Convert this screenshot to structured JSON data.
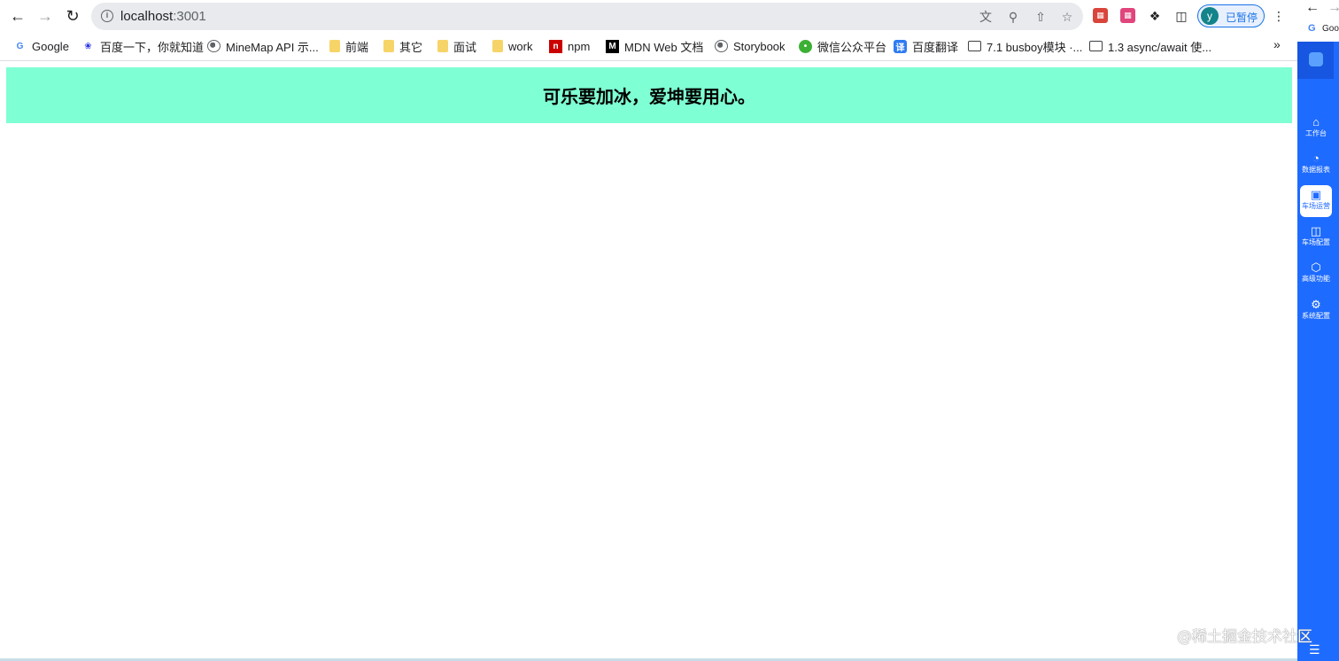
{
  "browser": {
    "url_host": "localhost",
    "url_port": ":3001",
    "profile": {
      "initial": "y",
      "status": "已暂停"
    },
    "bookmarks": [
      {
        "label": "Google",
        "icon": "google-icon"
      },
      {
        "label": "百度一下，你就知道",
        "icon": "baidu-icon"
      },
      {
        "label": "MineMap API 示...",
        "icon": "globe-icon"
      },
      {
        "label": "前端",
        "icon": "folder-icon"
      },
      {
        "label": "其它",
        "icon": "folder-icon"
      },
      {
        "label": "面试",
        "icon": "folder-icon"
      },
      {
        "label": "work",
        "icon": "folder-icon"
      },
      {
        "label": "npm",
        "icon": "npm-icon"
      },
      {
        "label": "MDN Web 文档",
        "icon": "mdn-icon"
      },
      {
        "label": "Storybook",
        "icon": "globe-icon"
      },
      {
        "label": "微信公众平台",
        "icon": "wechat-icon"
      },
      {
        "label": "百度翻译",
        "icon": "translate-icon"
      },
      {
        "label": "7.1 busboy模块 ·...",
        "icon": "book-icon"
      },
      {
        "label": "1.3 async/await 使...",
        "icon": "book-icon"
      }
    ],
    "more_bookmarks": "»"
  },
  "page": {
    "banner_text": "可乐要加冰，爱坤要用心。",
    "banner_color": "#7fffd4"
  },
  "side_panel": {
    "top_label": "Goo",
    "items": [
      {
        "label": "工作台",
        "icon": "home-icon"
      },
      {
        "label": "数据报表",
        "icon": "pie-chart-icon"
      },
      {
        "label": "车场运营",
        "icon": "car-icon",
        "active": true
      },
      {
        "label": "车场配置",
        "icon": "sliders-icon"
      },
      {
        "label": "高级功能",
        "icon": "cube-icon"
      },
      {
        "label": "系统配置",
        "icon": "gear-icon"
      }
    ],
    "accent_color": "#1e6bff"
  },
  "watermark": "@稀土掘金技术社区"
}
